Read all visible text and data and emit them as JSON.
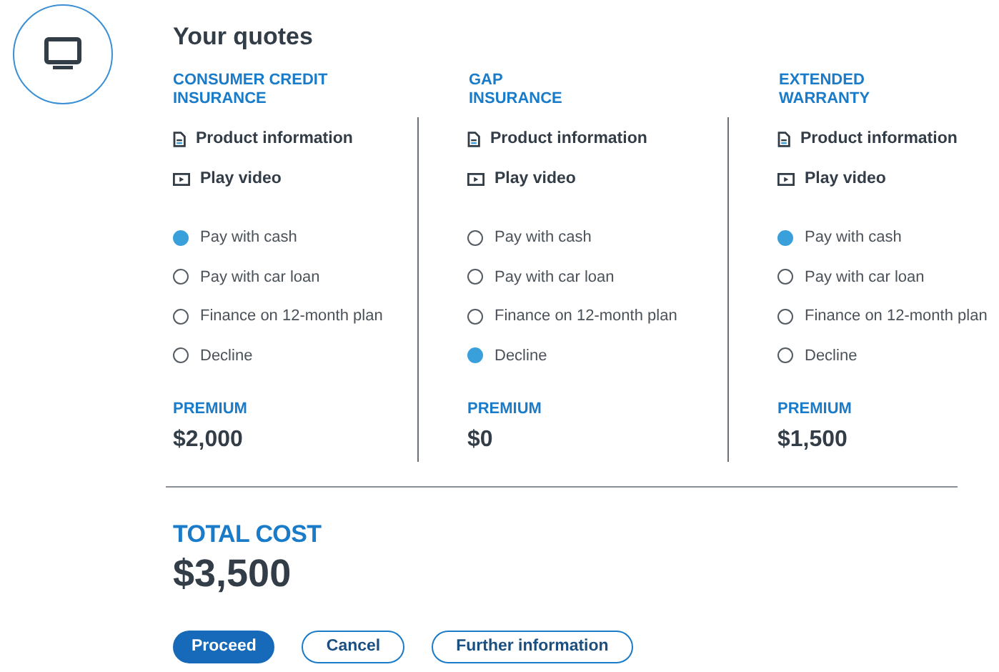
{
  "title": "Your quotes",
  "products": [
    {
      "name": "CONSUMER CREDIT\nINSURANCE",
      "links": [
        {
          "kind": "document",
          "label": "Product information"
        },
        {
          "kind": "video",
          "label": "Play video"
        }
      ],
      "options": [
        {
          "label": "Pay with cash",
          "selected": true
        },
        {
          "label": "Pay with car loan",
          "selected": false
        },
        {
          "label": "Finance on 12-month plan",
          "selected": false
        },
        {
          "label": "Decline",
          "selected": false
        }
      ],
      "premium_label": "PREMIUM",
      "premium": "$2,000"
    },
    {
      "name": "GAP\nINSURANCE",
      "links": [
        {
          "kind": "document",
          "label": "Product information"
        },
        {
          "kind": "video",
          "label": "Play video"
        }
      ],
      "options": [
        {
          "label": "Pay with cash",
          "selected": false
        },
        {
          "label": "Pay with car loan",
          "selected": false
        },
        {
          "label": "Finance on 12-month plan",
          "selected": false
        },
        {
          "label": "Decline",
          "selected": true
        }
      ],
      "premium_label": "PREMIUM",
      "premium": "$0"
    },
    {
      "name": "EXTENDED\nWARRANTY",
      "links": [
        {
          "kind": "document",
          "label": "Product information"
        },
        {
          "kind": "video",
          "label": "Play video"
        }
      ],
      "options": [
        {
          "label": "Pay with cash",
          "selected": true
        },
        {
          "label": "Pay with car loan",
          "selected": false
        },
        {
          "label": "Finance on 12-month plan",
          "selected": false
        },
        {
          "label": "Decline",
          "selected": false
        }
      ],
      "premium_label": "PREMIUM",
      "premium": "$1,500"
    }
  ],
  "total": {
    "label": "TOTAL COST",
    "value": "$3,500"
  },
  "buttons": [
    {
      "kind": "primary",
      "label": "Proceed"
    },
    {
      "kind": "outline",
      "label": "Cancel"
    },
    {
      "kind": "outline",
      "label": "Further information"
    }
  ]
}
